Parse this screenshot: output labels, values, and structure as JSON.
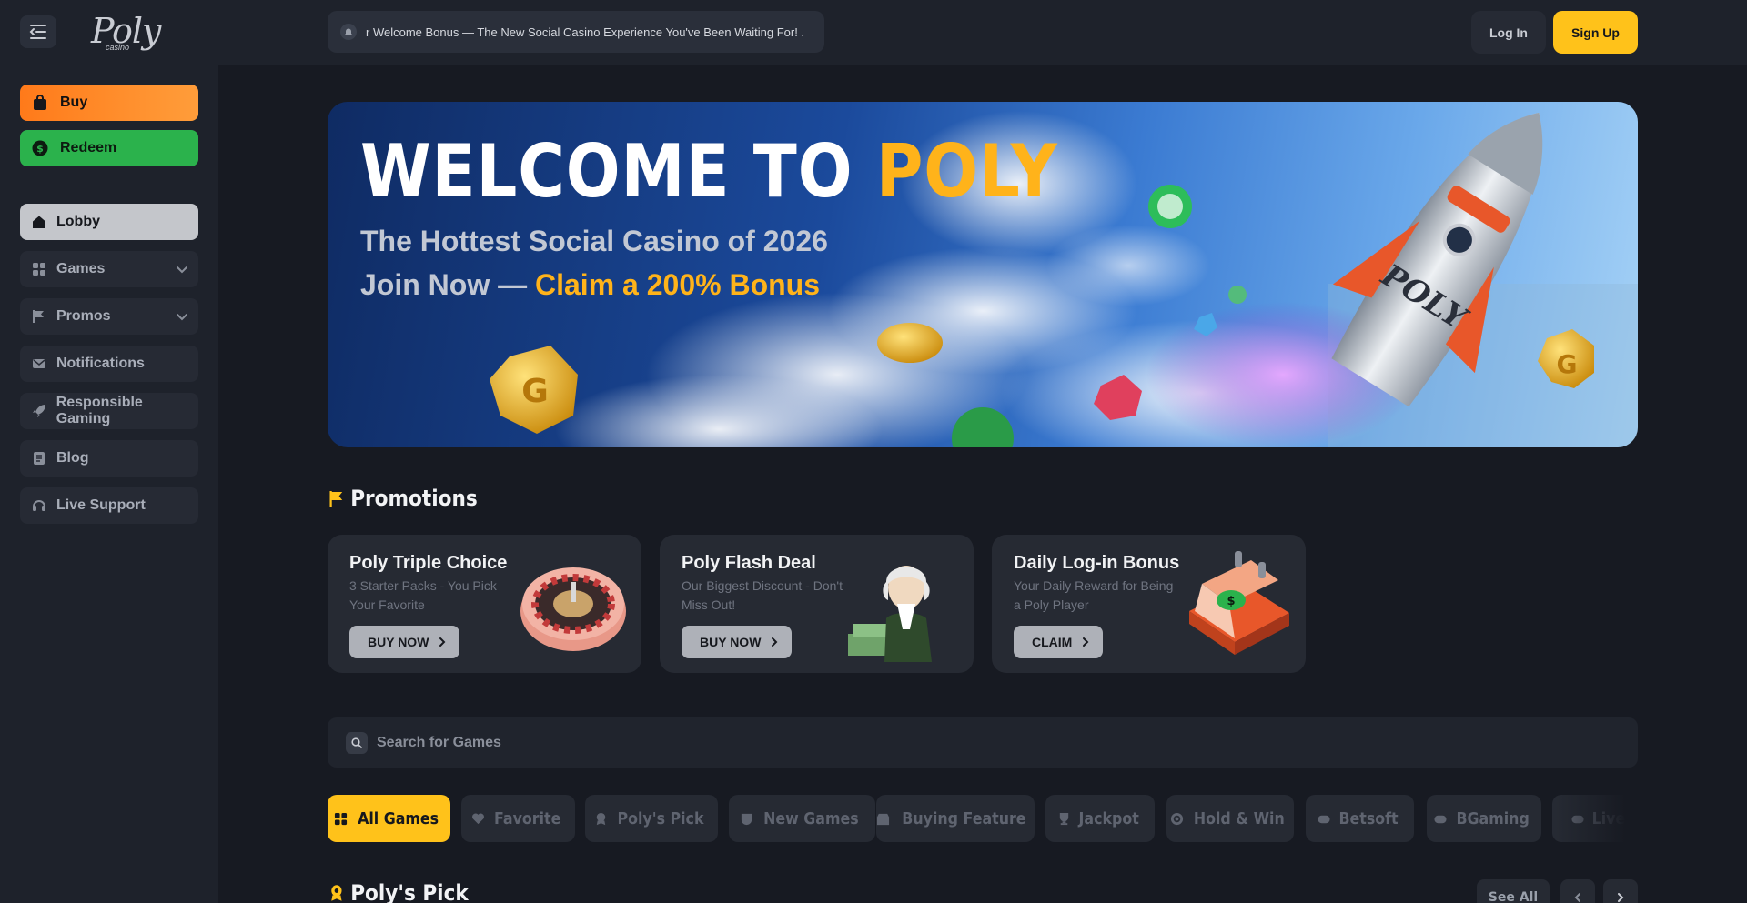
{
  "brand": {
    "logo_main": "Poly",
    "logo_sub": "casino"
  },
  "sidebar": {
    "buy_label": "Buy",
    "redeem_label": "Redeem",
    "items": [
      {
        "label": "Lobby",
        "icon": "home-icon",
        "active": true
      },
      {
        "label": "Games",
        "icon": "grid-icon",
        "expandable": true
      },
      {
        "label": "Promos",
        "icon": "flag-icon",
        "expandable": true
      },
      {
        "label": "Notifications",
        "icon": "mail-icon"
      },
      {
        "label": "Responsible Gaming",
        "icon": "rocket-icon"
      },
      {
        "label": "Blog",
        "icon": "document-icon"
      },
      {
        "label": "Live Support",
        "icon": "headset-icon"
      }
    ]
  },
  "header": {
    "ticker": "r Welcome Bonus — The New Social Casino Experience You've Been Waiting For! .",
    "login_label": "Log In",
    "signup_label": "Sign Up"
  },
  "hero": {
    "title_prefix": "WELCOME TO ",
    "title_accent": "POLY",
    "line1": "The Hottest Social Casino of 2026",
    "line2_prefix": "Join Now — ",
    "line2_accent": "Claim a 200% Bonus"
  },
  "promotions": {
    "title": "Promotions",
    "cards": [
      {
        "title": "Poly Triple Choice",
        "desc": "3 Starter Packs - You Pick Your Favorite",
        "button": "BUY NOW",
        "image": "roulette-wheel"
      },
      {
        "title": "Poly Flash Deal",
        "desc": "Our Biggest Discount - Don't Miss Out!",
        "button": "BUY NOW",
        "image": "founding-father-with-cash"
      },
      {
        "title": "Daily Log-in Bonus",
        "desc": "Your Daily Reward for Being a Poly Player",
        "button": "CLAIM",
        "image": "calendar-with-coin"
      }
    ]
  },
  "search": {
    "placeholder": "Search for Games",
    "value": ""
  },
  "tabs": [
    {
      "label": "All Games",
      "icon": "grid-icon",
      "active": true
    },
    {
      "label": "Favorite",
      "icon": "heart-icon"
    },
    {
      "label": "Poly's Pick",
      "icon": "award-icon"
    },
    {
      "label": "New Games",
      "icon": "badge-icon"
    },
    {
      "label": "Buying Feature",
      "icon": "shop-icon"
    },
    {
      "label": "Jackpot",
      "icon": "trophy-icon"
    },
    {
      "label": "Hold & Win",
      "icon": "target-icon"
    },
    {
      "label": "Betsoft",
      "icon": "gamepad-icon"
    },
    {
      "label": "BGaming",
      "icon": "gamepad-icon"
    },
    {
      "label": "Live C",
      "icon": "gamepad-icon"
    }
  ],
  "polys_pick": {
    "title": "Poly's Pick",
    "see_all_label": "See All"
  },
  "colors": {
    "accent": "#ffc21a",
    "buy": "#ff8a26",
    "redeem": "#2bb24c",
    "background": "#171a22",
    "hero_accent": "#ffb31a"
  }
}
